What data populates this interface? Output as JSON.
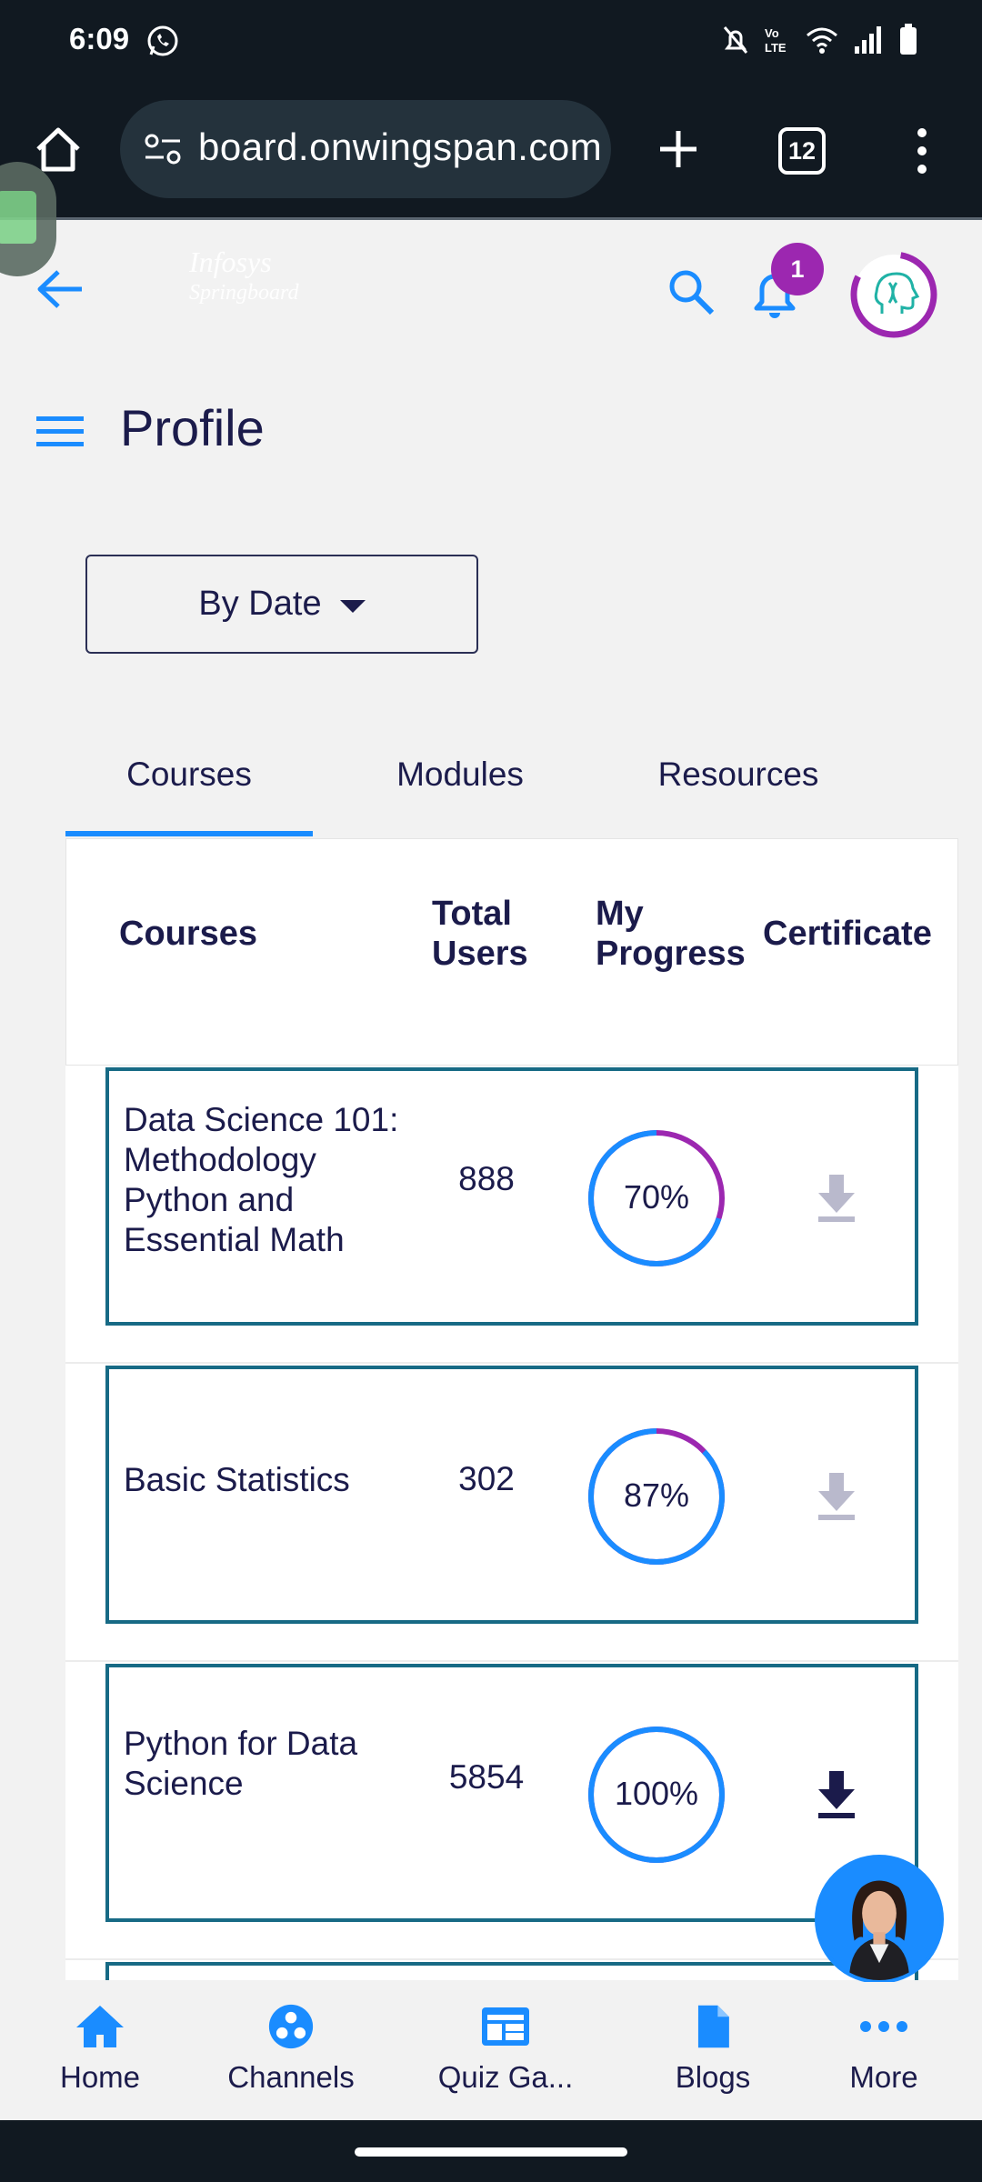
{
  "status_bar": {
    "time": "6:09",
    "icons": [
      "whatsapp-icon",
      "mute-icon",
      "volte-icon",
      "wifi-icon",
      "signal-icon",
      "battery-icon"
    ]
  },
  "browser": {
    "url": "board.onwingspan.com",
    "tab_count": "12",
    "icons": [
      "home-icon",
      "site-settings-icon",
      "new-tab-icon",
      "tab-switcher-icon",
      "more-vert-icon"
    ]
  },
  "header": {
    "brand_line1": "Infosys",
    "brand_line2": "Springboard",
    "notification_count": "1",
    "accent_color": "#1a8cff",
    "badge_color": "#9c27b0"
  },
  "page": {
    "title": "Profile",
    "sort_label": "By Date"
  },
  "tabs": [
    {
      "label": "Courses",
      "active": true
    },
    {
      "label": "Modules",
      "active": false
    },
    {
      "label": "Resources",
      "active": false
    }
  ],
  "table": {
    "headers": {
      "course": "Courses",
      "users_line1": "Total",
      "users_line2": "Users",
      "progress_line1": "My",
      "progress_line2": "Progress",
      "certificate": "Certificate"
    },
    "rows": [
      {
        "name_lines": [
          "Data Science 101:",
          "Methodology",
          "Python and",
          "Essential Math"
        ],
        "users": "888",
        "progress": 0.7,
        "progress_label": "70%",
        "certificate_available": false
      },
      {
        "name_lines": [
          "Basic Statistics"
        ],
        "users": "302",
        "progress": 0.87,
        "progress_label": "87%",
        "certificate_available": false
      },
      {
        "name_lines": [
          "Python for Data",
          "Science"
        ],
        "users": "5854",
        "progress": 1.0,
        "progress_label": "100%",
        "certificate_available": true
      }
    ]
  },
  "bottom_nav": [
    {
      "label": "Home",
      "icon": "home-icon"
    },
    {
      "label": "Channels",
      "icon": "channels-icon"
    },
    {
      "label": "Quiz Ga...",
      "icon": "quiz-icon"
    },
    {
      "label": "Blogs",
      "icon": "blog-icon"
    },
    {
      "label": "More",
      "icon": "more-horiz-icon"
    }
  ]
}
